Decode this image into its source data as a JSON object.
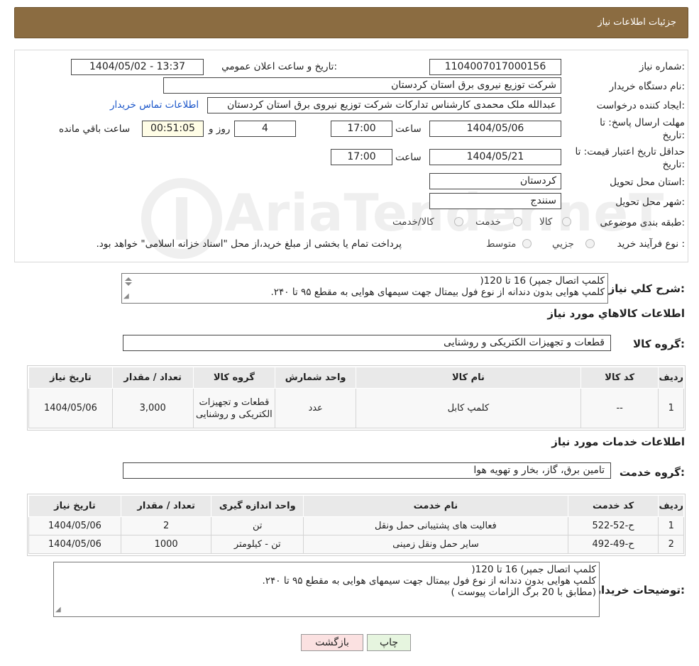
{
  "header": {
    "title": "جزئیات اطلاعات نیاز"
  },
  "form": {
    "need_number_label": "شماره نیاز:",
    "need_number": "1104007017000156",
    "announce_label": "تاریخ و ساعت اعلان عمومي:",
    "announce_value": "1404/05/02 - 13:37",
    "buyer_org_label": "نام دستگاه خریدار:",
    "buyer_org": "شرکت توزیع نیروی برق استان کردستان",
    "creator_label": "ایجاد کننده درخواست:",
    "creator": "عبدالله ملک محمدی کارشناس تدارکات شرکت توزیع نیروی برق استان کردستان",
    "contact_link": "اطلاعات تماس خریدار",
    "deadline_label_1": "مهلت ارسال پاسخ: تا",
    "deadline_label_2": "تاریخ:",
    "deadline_date": "1404/05/06",
    "time_label": "ساعت",
    "deadline_time": "17:00",
    "days_value": "4",
    "days_label": "روز و",
    "remaining_value": "00:51:05",
    "remaining_label": "ساعت باقي مانده",
    "validity_label_1": "حداقل تاریخ اعتبار قیمت: تا",
    "validity_label_2": "تاریخ:",
    "validity_date": "1404/05/21",
    "validity_time": "17:00",
    "province_label": "استان محل تحویل:",
    "province": "کردستان",
    "city_label": "شهر محل تحویل:",
    "city": "سنندج",
    "category_label": "طبقه بندی موضوعی:",
    "category_options": [
      "کالا",
      "خدمت",
      "کالا/خدمت"
    ],
    "process_label": "نوع فرآیند خرید :",
    "process_options": [
      "جزیي",
      "متوسط"
    ],
    "process_note": "پرداخت تمام یا بخشی از مبلغ خرید،از محل \"اسناد خزانه اسلامی\" خواهد بود."
  },
  "watermark": {
    "text": "AriaTender.neT"
  },
  "description": {
    "label": "شرح کلي نیاز:",
    "lines": [
      "کلمپ اتصال جمپر)  16 تا 120(",
      "کلمپ هوایی بدون دندانه از نوع فول بیمتال جهت سیمهای هوایی به مقطع ۹۵ تا ۲۴۰."
    ]
  },
  "goods": {
    "section_title": "اطلاعات کالاهاي مورد نیاز",
    "group_label": "گروه کالا:",
    "group_value": "قطعات و تجهیزات الکتریکی و روشنایی",
    "columns": [
      "ردیف",
      "کد کالا",
      "نام کالا",
      "واحد شمارش",
      "گروه کالا",
      "تعداد / مقدار",
      "تاریخ نیاز"
    ],
    "rows": [
      {
        "row": "1",
        "code": "--",
        "name": "کلمپ کابل",
        "unit": "عدد",
        "group": "قطعات و تجهیزات الکتریکی و روشنایی",
        "qty": "3,000",
        "date": "1404/05/06"
      }
    ]
  },
  "services": {
    "section_title": "اطلاعات خدمات مورد نیاز",
    "group_label": "گروه خدمت:",
    "group_value": "تامین برق، گاز، بخار و تهویه هوا",
    "columns": [
      "ردیف",
      "کد خدمت",
      "نام خدمت",
      "واحد اندازه گیری",
      "تعداد / مقدار",
      "تاریخ نیاز"
    ],
    "rows": [
      {
        "row": "1",
        "code": "ح-52-522",
        "name": "فعالیت های پشتیبانی حمل ونقل",
        "unit": "تن",
        "qty": "2",
        "date": "1404/05/06"
      },
      {
        "row": "2",
        "code": "ح-49-492",
        "name": "سایر حمل ونقل زمینی",
        "unit": "تن - کیلومتر",
        "qty": "1000",
        "date": "1404/05/06"
      }
    ]
  },
  "buyer_notes": {
    "label": "توضیحات خریدار:",
    "lines": [
      "کلمپ اتصال جمپر)  16 تا 120(",
      "کلمپ هوایی بدون دندانه از نوع فول بیمتال جهت سیمهای هوایی به مقطع ۹۵ تا ۲۴۰.",
      "(مطابق با 20 برگ الزامات پیوست )"
    ]
  },
  "buttons": {
    "back": "بازگشت",
    "print": "چاپ"
  }
}
